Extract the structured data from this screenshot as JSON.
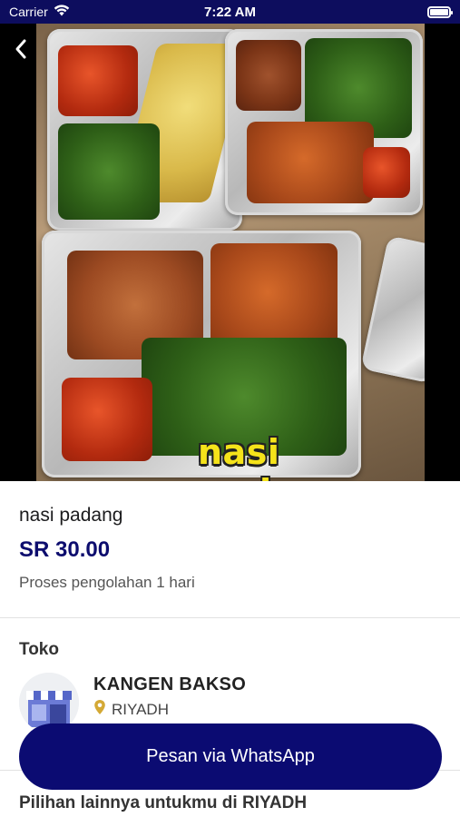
{
  "status_bar": {
    "carrier": "Carrier",
    "time": "7:22 AM",
    "wifi_icon": "wifi-icon",
    "battery_icon": "battery-icon"
  },
  "hero": {
    "overlay_caption": "nasi padang",
    "back_icon": "chevron-left-icon"
  },
  "product": {
    "title": "nasi padang",
    "price": "SR 30.00",
    "processing_note": "Proses pengolahan 1 hari"
  },
  "store": {
    "heading": "Toko",
    "name": "KANGEN BAKSO",
    "location": "RIYADH",
    "location_icon": "location-pin-icon",
    "pin_color": "#d4a935"
  },
  "actions": {
    "whatsapp_label": "Pesan via WhatsApp",
    "button_color": "#0b0b72"
  },
  "recommendations": {
    "heading": "Pilihan lainnya untukmu di RIYADH"
  },
  "theme": {
    "status_bar_bg": "#0d0d5e",
    "price_color": "#0d0d6e"
  }
}
